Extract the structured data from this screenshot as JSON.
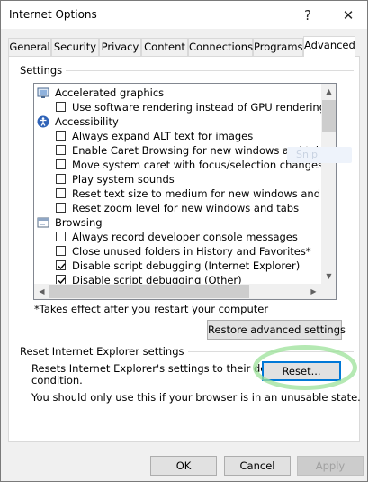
{
  "window": {
    "title": "Internet Options",
    "help_glyph": "?",
    "close_glyph": "✕"
  },
  "tabs": [
    {
      "label": "General",
      "active": false
    },
    {
      "label": "Security",
      "active": false
    },
    {
      "label": "Privacy",
      "active": false
    },
    {
      "label": "Content",
      "active": false
    },
    {
      "label": "Connections",
      "active": false
    },
    {
      "label": "Programs",
      "active": false
    },
    {
      "label": "Advanced",
      "active": true
    }
  ],
  "settings": {
    "group_label": "Settings",
    "items": [
      {
        "kind": "category",
        "label": "Accelerated graphics",
        "icon": "monitor-icon"
      },
      {
        "kind": "checkbox",
        "label": "Use software rendering instead of GPU rendering*",
        "checked": false
      },
      {
        "kind": "category",
        "label": "Accessibility",
        "icon": "accessibility-icon"
      },
      {
        "kind": "checkbox",
        "label": "Always expand ALT text for images",
        "checked": false
      },
      {
        "kind": "checkbox",
        "label": "Enable Caret Browsing for new windows and tabs",
        "checked": false
      },
      {
        "kind": "checkbox",
        "label": "Move system caret with focus/selection changes",
        "checked": false
      },
      {
        "kind": "checkbox",
        "label": "Play system sounds",
        "checked": false
      },
      {
        "kind": "checkbox",
        "label": "Reset text size to medium for new windows and tabs",
        "checked": false
      },
      {
        "kind": "checkbox",
        "label": "Reset zoom level for new windows and tabs",
        "checked": false
      },
      {
        "kind": "category",
        "label": "Browsing",
        "icon": "browser-window-icon"
      },
      {
        "kind": "checkbox",
        "label": "Always record developer console messages",
        "checked": false
      },
      {
        "kind": "checkbox",
        "label": "Close unused folders in History and Favorites*",
        "checked": false
      },
      {
        "kind": "checkbox",
        "label": "Disable script debugging (Internet Explorer)",
        "checked": true
      },
      {
        "kind": "checkbox",
        "label": "Disable script debugging (Other)",
        "checked": true
      }
    ],
    "ghost_tooltip": "Snip",
    "footnote": "*Takes effect after you restart your computer",
    "restore_button": "Restore advanced settings"
  },
  "reset": {
    "group_label": "Reset Internet Explorer settings",
    "description_line1": "Resets Internet Explorer's settings to their default",
    "description_line2": "condition.",
    "warning": "You should only use this if your browser is in an unusable state.",
    "reset_button": "Reset..."
  },
  "footer": {
    "ok": "OK",
    "cancel": "Cancel",
    "apply": "Apply"
  }
}
